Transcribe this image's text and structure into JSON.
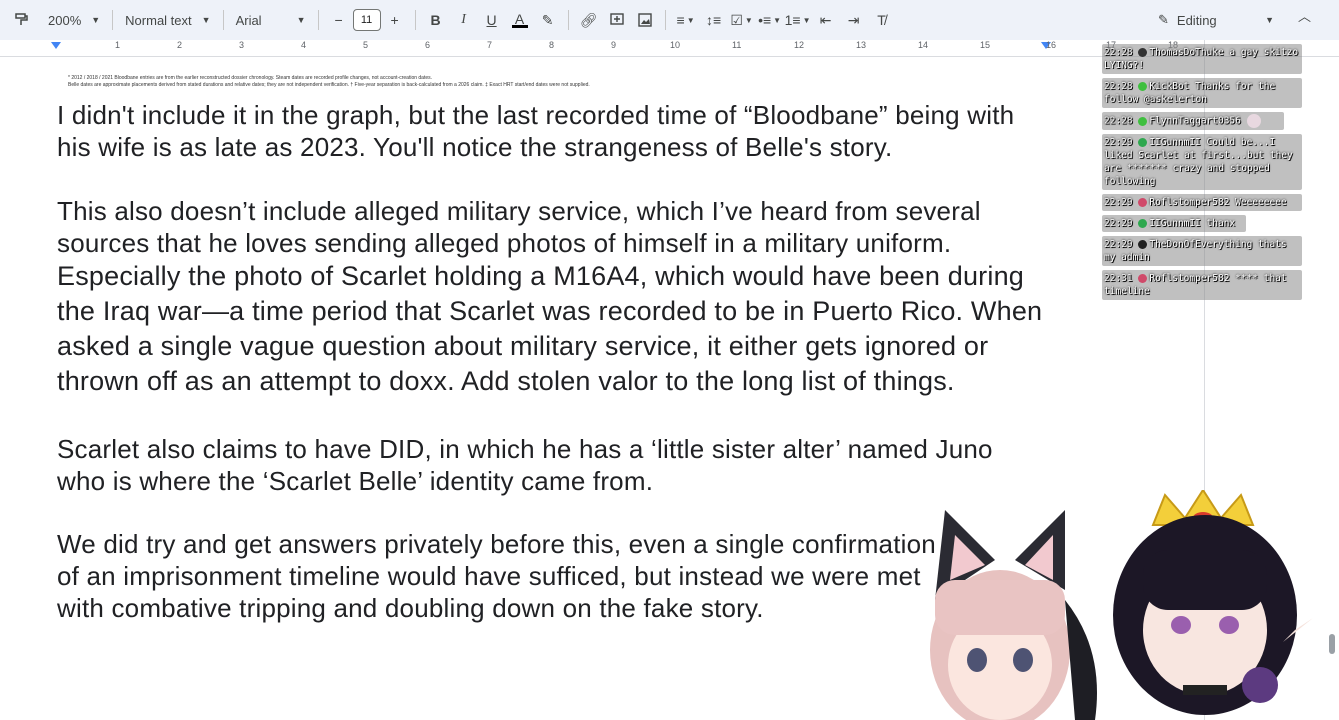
{
  "toolbar": {
    "zoom": "200%",
    "style": "Normal text",
    "font": "Arial",
    "font_size": "11",
    "mode": "Editing"
  },
  "ruler": {
    "numbers": [
      "1",
      "2",
      "3",
      "4",
      "5",
      "6",
      "7",
      "8",
      "9",
      "10",
      "11",
      "12",
      "13",
      "14",
      "15",
      "16",
      "17",
      "18"
    ]
  },
  "document": {
    "footnote_line1": "* 2012 / 2018 / 2021 Bloodbane entries are from the earlier reconstructed dossier chronology. Steam dates are recorded profile changes, not account-creation dates.",
    "footnote_line2": "Belle dates are approximate placements derived from stated durations and relative dates; they are not independent verification. † Five-year separation is back-calculated from a 2026 claim. ‡ Exact HRT start/end dates were not supplied.",
    "p1": "I didn't include it in the graph, but the last recorded time of “Bloodbane” being with his wife is as late as 2023. You'll notice the strangeness of Belle's story.",
    "p2a": "This also doesn’t include alleged military service, which I’ve heard from several sources that he loves sending alleged photos of himself in a military uniform. ",
    "p2b": "Especially the photo of Scarlet holding a M16A4, which would have been during the Iraq war—a time period that Scarlet was recorded to be in Puerto Rico. When asked a single vague question about military service, it either gets ignored or thrown off as an attempt to doxx. Add stolen valor to the long list of things.",
    "p3": "Scarlet also claims to have DID, in which he has a ‘little sister alter’ named Juno who is where the ‘Scarlet Belle’ identity came from.",
    "p4": "We did try and get answers privately before this, even a single confirmation of an imprisonment timeline would have sufficed, but instead we were met with combative tripping and doubling down on the fake story."
  },
  "chat": [
    {
      "time": "22:28",
      "text": "ThomasDoThuke a gay skitzo LYING?!"
    },
    {
      "time": "22:28",
      "text": "KickBot Thanks for the follow @askelerton"
    },
    {
      "time": "22:28",
      "text": "FlynnTaggart0356"
    },
    {
      "time": "22:29",
      "text": "IIGunnmII Could be...I liked Scarlet at first...but they are ******* crazy and stopped following"
    },
    {
      "time": "22:29",
      "text": "Roflstomper582 Weeeeeeee"
    },
    {
      "time": "22:29",
      "text": "IIGunnmII thanx"
    },
    {
      "time": "22:29",
      "text": "TheDonOfEverything thats my admin"
    },
    {
      "time": "22:31",
      "text": "Roflstomper582 **** that timeline"
    }
  ],
  "colors": {
    "toolbar_bg": "#eef2f9",
    "accent": "#4285f4",
    "text": "#202124"
  }
}
